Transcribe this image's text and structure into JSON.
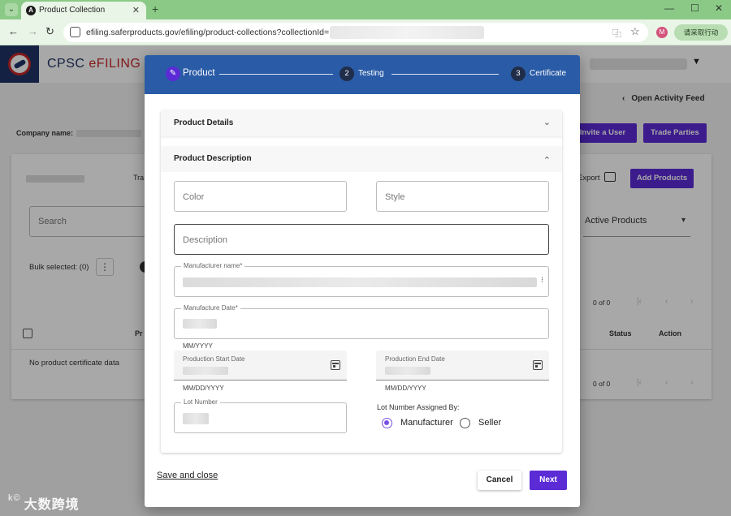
{
  "browser": {
    "tab_title": "Product Collection",
    "favicon_letter": "A",
    "url": "efiling.saferproducts.gov/efiling/product-collections?collectionId=",
    "profile_initial": "M",
    "translate_label": "请采取行动",
    "new_tab": "+",
    "close": "✕",
    "tab_menu": "⌄",
    "back": "←",
    "forward": "→",
    "reload": "↻",
    "min": "—",
    "max": "☐",
    "win_close": "✕",
    "translate_icon": "⿻",
    "star": "☆"
  },
  "header": {
    "brand_prefix": "CPSC ",
    "brand_accent": "eFILING",
    "caret": "▼"
  },
  "page": {
    "open_activity_feed": "Open Activity Feed",
    "activity_chevron": "‹",
    "company_label": "Company name:",
    "invite_user": "Invite a User",
    "trade_parties": "Trade Parties",
    "tr_label": "Tra",
    "export_label": "Export",
    "add_products": "Add Products",
    "search_placeholder": "Search",
    "active_products": "Active Products",
    "bulk_selected": "Bulk selected: (0)",
    "kebab": "⋮",
    "pagination_1": "0 of 0",
    "pagination_2": "0 of 0",
    "arrow_first": "|‹",
    "arrow_prev": "‹",
    "arrow_next": "›",
    "col_pr": "Pr",
    "col_status": "Status",
    "col_action": "Action",
    "no_data": "No product certificate data"
  },
  "watermark": {
    "prefix": "k©",
    "text": "大数跨境"
  },
  "modal": {
    "steps": [
      {
        "number": "✎",
        "label": "Product",
        "active": true
      },
      {
        "number": "2",
        "label": "Testing",
        "active": false
      },
      {
        "number": "3",
        "label": "Certificate",
        "active": false
      }
    ],
    "sections": {
      "details_title": "Product Details",
      "details_chevron": "⌄",
      "description_title": "Product Description",
      "description_chevron": "⌃"
    },
    "fields": {
      "color_placeholder": "Color",
      "style_placeholder": "Style",
      "description_placeholder": "Description",
      "manufacturer_name_label": "Manufacturer name*",
      "manufacture_date_label": "Manufacture Date*",
      "manufacture_date_helper": "MM/YYYY",
      "production_start_label": "Production Start Date",
      "production_start_helper": "MM/DD/YYYY",
      "production_end_label": "Production End Date",
      "production_end_helper": "MM/DD/YYYY",
      "lot_number_label": "Lot Number",
      "lot_assigned_label": "Lot Number Assigned By:",
      "radio_manufacturer": "Manufacturer",
      "radio_seller": "Seller",
      "selected_radio": "Manufacturer"
    },
    "footer": {
      "save_close": "Save and close",
      "cancel": "Cancel",
      "next": "Next"
    }
  },
  "colors": {
    "accent_purple": "#5b2bd6",
    "stepper_blue": "#2a5ba6",
    "brand_navy": "#1f3266",
    "brand_red": "#c62828",
    "chrome_green": "#8bc987"
  }
}
